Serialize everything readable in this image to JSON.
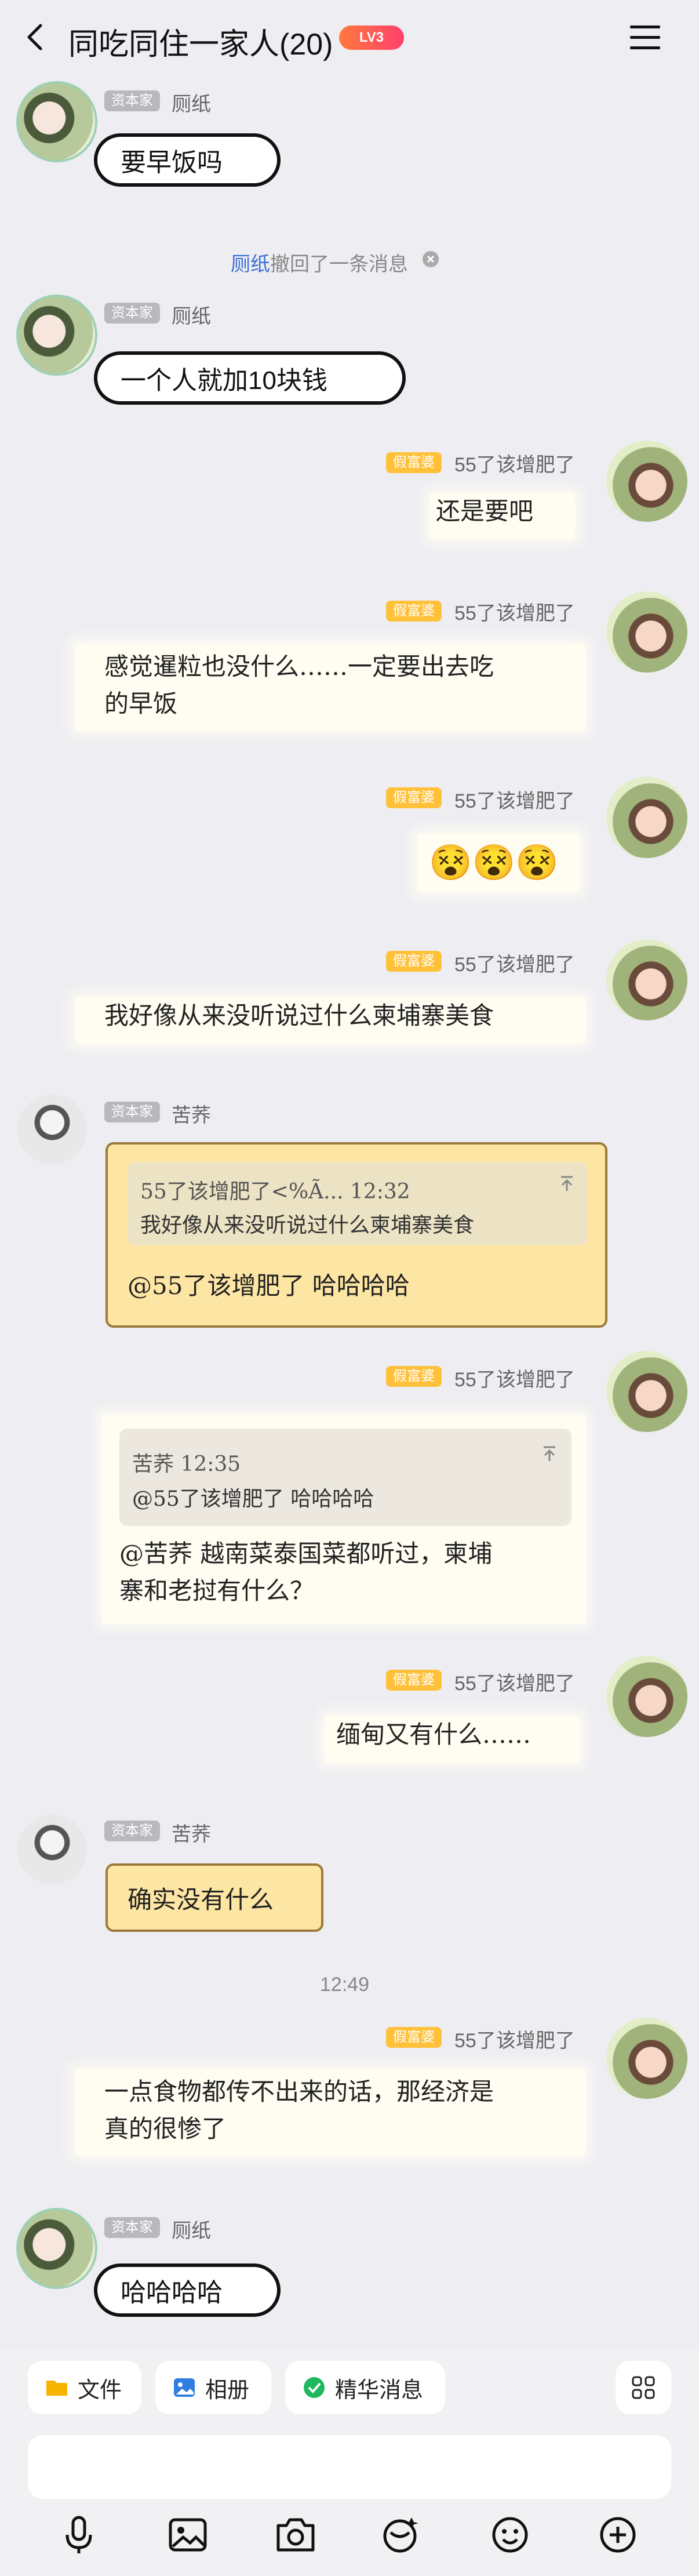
{
  "header": {
    "title": "同吃同住一家人(20)",
    "badge": "LV3"
  },
  "ranks": {
    "capitalist": "资本家",
    "fake_rich": "假富婆"
  },
  "users": {
    "u1": "厕纸",
    "u2": "55了该增肥了",
    "u3": "苦荞"
  },
  "messages": {
    "m1": "要早饭吗",
    "recall_name": "厕纸",
    "recall_text": "撤回了一条消息",
    "m2": "一个人就加10块钱",
    "m3": "还是要吧",
    "m4_l1": "感觉暹粒也没什么……一定要出去吃",
    "m4_l2": "的早饭",
    "m5": "😵😵😵",
    "m6": "我好像从来没听说过什么柬埔寨美食",
    "m7_quote_head": "55了该增肥了<%Ã... 12:32",
    "m7_quote_text": "我好像从来没听说过什么柬埔寨美食",
    "m7": "@55了该增肥了 哈哈哈哈",
    "m8_quote_head": "苦荞 12:35",
    "m8_quote_text": "@55了该增肥了 哈哈哈哈",
    "m8_l1": "@苦荞 越南菜泰国菜都听过，柬埔",
    "m8_l2": "寨和老挝有什么？",
    "m9": "缅甸又有什么……",
    "m10": "确实没有什么",
    "time_sep": "12:49",
    "m11_l1": "一点食物都传不出来的话，那经济是",
    "m11_l2": "真的很惨了",
    "m12": "哈哈哈哈"
  },
  "toolbar": {
    "file": "文件",
    "album": "相册",
    "essence": "精华消息"
  },
  "colors": {
    "accent": "#3b6fd6",
    "gold": "#ffc03a",
    "bg": "#ededf2"
  }
}
